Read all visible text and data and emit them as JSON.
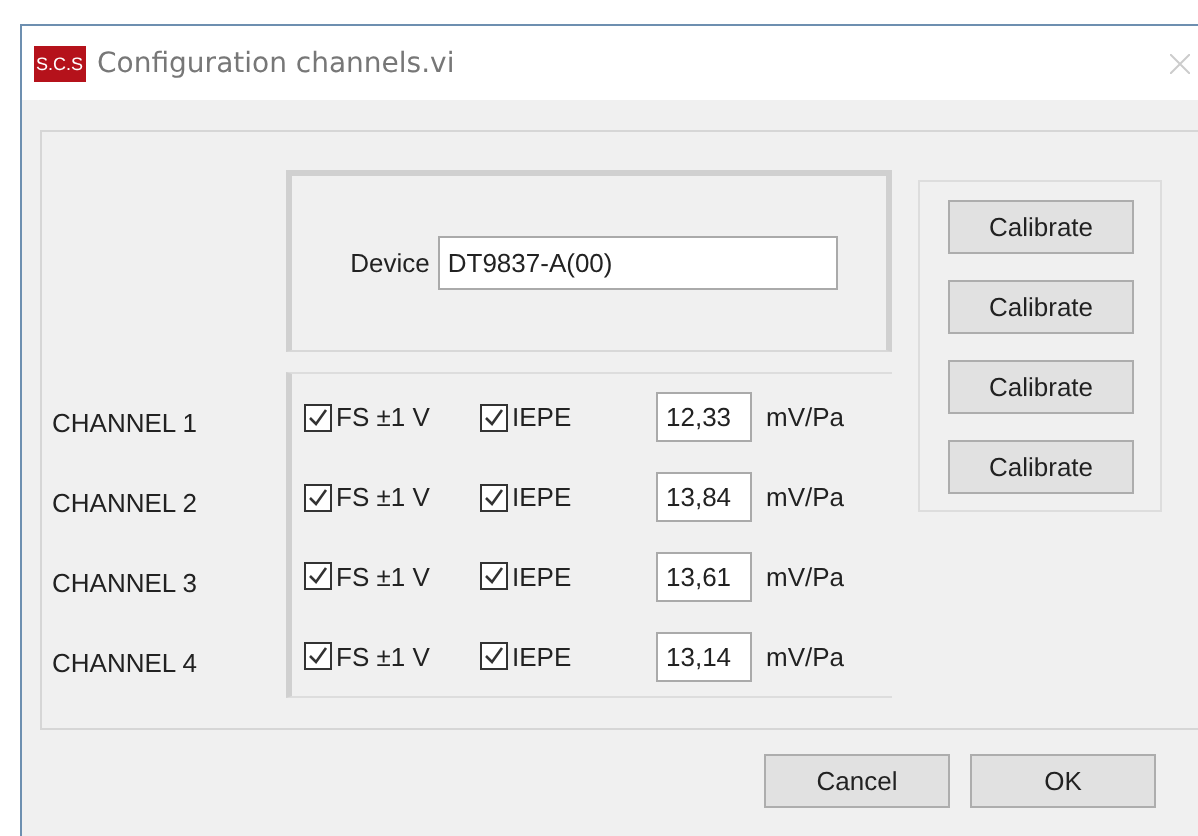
{
  "window": {
    "title": "Configuration channels.vi",
    "logo": "S.C.S"
  },
  "device": {
    "label": "Device",
    "value": "DT9837-A(00)"
  },
  "channels": [
    {
      "label": "CHANNEL 1",
      "fs": {
        "label": "FS ±1 V",
        "checked": true
      },
      "iepe": {
        "label": "IEPE",
        "checked": true
      },
      "sensitivity": "12,33",
      "unit": "mV/Pa",
      "button": "Calibrate"
    },
    {
      "label": "CHANNEL 2",
      "fs": {
        "label": "FS ±1 V",
        "checked": true
      },
      "iepe": {
        "label": "IEPE",
        "checked": true
      },
      "sensitivity": "13,84",
      "unit": "mV/Pa",
      "button": "Calibrate"
    },
    {
      "label": "CHANNEL 3",
      "fs": {
        "label": "FS ±1 V",
        "checked": true
      },
      "iepe": {
        "label": "IEPE",
        "checked": true
      },
      "sensitivity": "13,61",
      "unit": "mV/Pa",
      "button": "Calibrate"
    },
    {
      "label": "CHANNEL 4",
      "fs": {
        "label": "FS ±1 V",
        "checked": true
      },
      "iepe": {
        "label": "IEPE",
        "checked": true
      },
      "sensitivity": "13,14",
      "unit": "mV/Pa",
      "button": "Calibrate"
    }
  ],
  "buttons": [
    "Cancel",
    "OK"
  ]
}
